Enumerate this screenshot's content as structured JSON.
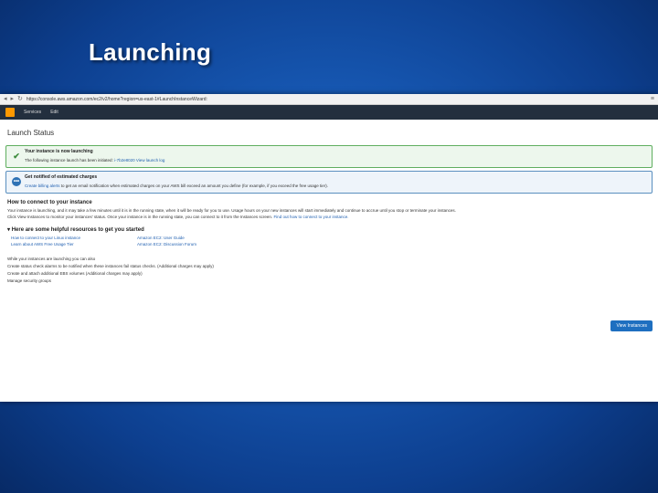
{
  "slide": {
    "title": "Launching"
  },
  "browser": {
    "url": "https://console.aws.amazon.com/ec2/v2/home?region=us-east-1#LaunchInstanceWizard:"
  },
  "aws_nav": {
    "services": "Services",
    "edit": "Edit",
    "right_items": [
      "",
      "",
      ""
    ]
  },
  "page": {
    "heading": "Launch Status",
    "success_box": {
      "title": "Your instance is now launching",
      "text": "The following instance launch has been initiated:",
      "instance_id": "i-7b2e8020",
      "log_link": "View launch log"
    },
    "info_box": {
      "title": "Get notified of estimated charges",
      "link": "Create billing alerts",
      "text": "to get an email notification when estimated charges on your AWS bill exceed an amount you define (for example, if you exceed the free usage tier)."
    },
    "connect": {
      "heading": "How to connect to your instance",
      "para1": "Your instance is launching, and it may take a few minutes until it is in the running state, when it will be ready for you to use. Usage hours on your new instances will start immediately and continue to accrue until you stop or terminate your instances.",
      "para2_text": "Click View Instances to monitor your instances' status. Once your instance is in the running state, you can connect to it from the Instances screen.",
      "para2_link": "Find out how to connect to your instance."
    },
    "resources": {
      "heading": "Here are some helpful resources to get you started",
      "left": [
        "How to connect to your Linux instance",
        "Learn about AWS Free Usage Tier"
      ],
      "right": [
        "Amazon EC2: User Guide",
        "Amazon EC2: Discussion Forum"
      ]
    },
    "after": {
      "intro": "While your instances are launching you can also",
      "items": [
        "Create status check alarms to be notified when these instances fail status checks. (Additional charges may apply)",
        "Create and attach additional EBS volumes (Additional charges may apply)",
        "Manage security groups"
      ]
    },
    "view_button": "View Instances"
  }
}
